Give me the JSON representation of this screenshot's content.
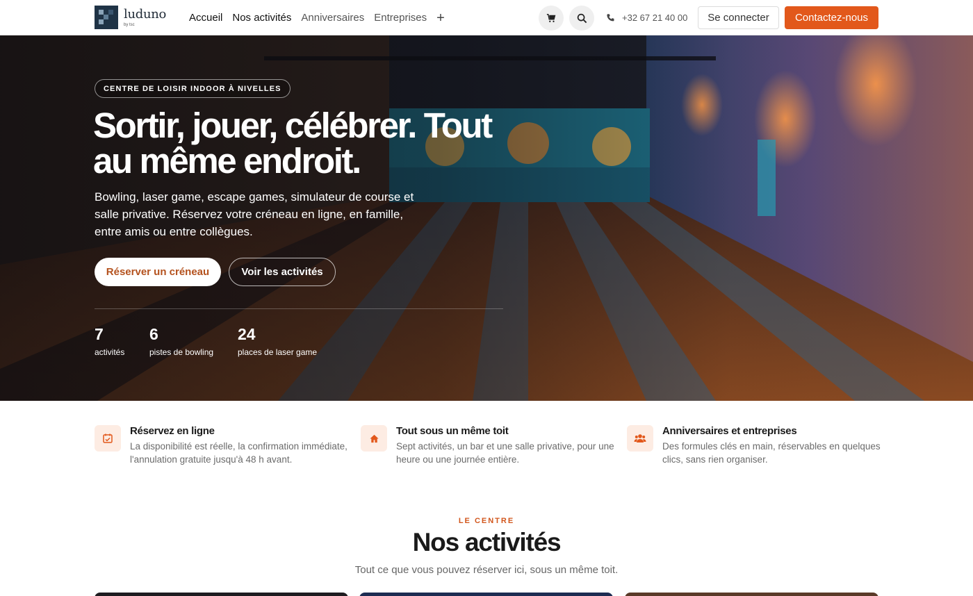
{
  "brand": {
    "name": "luduno",
    "sub": "by tsc"
  },
  "nav": {
    "items": [
      "Accueil",
      "Nos activités",
      "Anniversaires",
      "Entreprises"
    ],
    "more_icon": "plus-icon"
  },
  "header": {
    "cart_icon": "cart-icon",
    "search_icon": "search-icon",
    "phone_icon": "phone-icon",
    "phone": "+32 67 21 40 00",
    "login_label": "Se connecter",
    "contact_label": "Contactez-nous",
    "accent_color": "#e2581b"
  },
  "hero": {
    "badge": "CENTRE DE LOISIR INDOOR À NIVELLES",
    "title": "Sortir, jouer, célébrer. Tout au même endroit.",
    "subtitle": "Bowling, laser game, escape games, simulateur de course et salle privative. Réservez votre créneau en ligne, en famille, entre amis ou entre collègues.",
    "primary_cta": "Réserver un créneau",
    "secondary_cta": "Voir les activités",
    "stats": [
      {
        "value": "7",
        "label": "activités"
      },
      {
        "value": "6",
        "label": "pistes de bowling"
      },
      {
        "value": "24",
        "label": "places de laser game"
      }
    ]
  },
  "features": [
    {
      "icon": "calendar-check-icon",
      "title": "Réservez en ligne",
      "text": "La disponibilité est réelle, la confirmation immédiate, l'annulation gratuite jusqu'à 48 h avant."
    },
    {
      "icon": "home-icon",
      "title": "Tout sous un même toit",
      "text": "Sept activités, un bar et une salle privative, pour une heure ou une journée entière."
    },
    {
      "icon": "users-icon",
      "title": "Anniversaires et entreprises",
      "text": "Des formules clés en main, réservables en quelques clics, sans rien organiser."
    }
  ],
  "section": {
    "eyebrow": "LE CENTRE",
    "title": "Nos activités",
    "subtitle": "Tout ce que vous pouvez réserver ici, sous un même toit."
  }
}
